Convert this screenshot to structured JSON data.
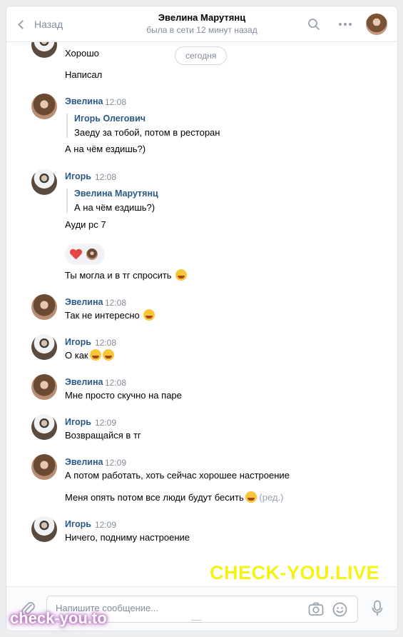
{
  "header": {
    "back_label": "Назад",
    "peer_name": "Эвелина Марутянц",
    "peer_status": "была в сети 12 минут назад"
  },
  "history": {
    "date_divider": "сегодня",
    "messages": [
      {
        "text": "Хорошо"
      },
      {
        "text": "Написал"
      },
      {
        "author": "Эвелина",
        "time": "12:08",
        "quote_author": "Игорь Олегович",
        "quote_text": "Заеду за тобой, потом в ресторан",
        "text": "А на чём ездишь?)"
      },
      {
        "author": "Игорь",
        "time": "12:08",
        "quote_author": "Эвелина Марутянц",
        "quote_text": "А на чём ездишь?)",
        "text": "Ауди рс 7",
        "reaction": "heart"
      },
      {
        "text": "Ты могла и в тг спросить",
        "emoji": "sweat-smile"
      },
      {
        "author": "Эвелина",
        "time": "12:08",
        "text": "Так не интересно",
        "emoji": "joy"
      },
      {
        "author": "Игорь",
        "time": "12:08",
        "text": "О как",
        "emoji": "joy-joy"
      },
      {
        "author": "Эвелина",
        "time": "12:08",
        "text": "Мне просто скучно на паре"
      },
      {
        "author": "Игорь",
        "time": "12:09",
        "text": "Возвращайся в тг"
      },
      {
        "author": "Эвелина",
        "time": "12:09",
        "text": "А потом работать, хоть сейчас хорошее настроение"
      },
      {
        "text": "Меня опять потом все люди будут бесить",
        "emoji": "joy",
        "edited": "(ред.)"
      },
      {
        "author": "Игорь",
        "time": "12:09",
        "text": "Ничего, подниму настроение"
      }
    ]
  },
  "composer": {
    "placeholder": "Напишите сообщение..."
  },
  "watermarks": {
    "main": "CHECK-YOU.LIVE",
    "brand": "check-you.to"
  },
  "colors": {
    "link": "#2a5885",
    "muted": "#818c99",
    "watermark": "#f3f315"
  }
}
